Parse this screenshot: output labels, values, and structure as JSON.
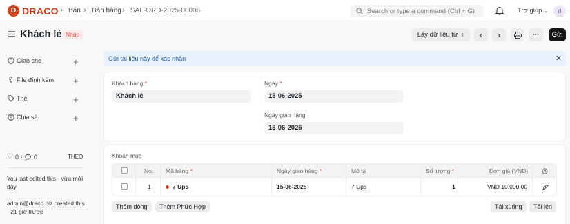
{
  "navbar": {
    "brand_initial": "D",
    "brand_name": "DRACO",
    "breadcrumbs": [
      "Bán",
      "Bán hàng",
      "SAL-ORD-2025-00006"
    ],
    "search_placeholder": "Search or type a command (Ctrl + G)",
    "help_label": "Trợ giúp",
    "avatar_initial": "d"
  },
  "page": {
    "title": "Khách lẻ",
    "status": "Nháp",
    "fetch_label": "Lấy dữ liệu từ",
    "more_label": "···",
    "submit_label": "Gửi"
  },
  "sidebar": {
    "items": [
      {
        "label": "Giao cho",
        "icon": "assign-icon"
      },
      {
        "label": "File đính kèm",
        "icon": "paperclip-icon"
      },
      {
        "label": "Thẻ",
        "icon": "tag-icon"
      },
      {
        "label": "Chia sẻ",
        "icon": "share-icon"
      }
    ],
    "likes": "0",
    "comments": "0",
    "follow_label": "THEO",
    "last_edited": "You last edited this · vừa mới đây",
    "created": "admin@draco.biz created this · 21 giờ trước"
  },
  "alert": {
    "text": "Gửi tài liệu này để xác nhận"
  },
  "form": {
    "customer_label": "Khách hàng",
    "customer_value": "Khách lẻ",
    "date_label": "Ngày",
    "date_value": "15-06-2025",
    "delivery_label": "Ngày giao hàng",
    "delivery_value": "15-06-2025"
  },
  "items": {
    "section_label": "Khoản mục",
    "columns": [
      "No.",
      "Mã hàng",
      "Ngày giao hàng",
      "Mô tả",
      "Số lượng",
      "Đơn giá (VND)"
    ],
    "rows": [
      {
        "no": "1",
        "item_code": "7 Ups",
        "delivery_date": "15-06-2025",
        "description": "7 Ups",
        "qty": "1",
        "rate": "VND 10.000,00"
      }
    ],
    "add_row": "Thêm dòng",
    "add_multiple": "Thêm Phức Hợp",
    "download": "Tải xuống",
    "upload": "Tải lên"
  },
  "colors": {
    "brand": "#d5421c",
    "required": "#e24c4c",
    "alert_bg": "#e8f2fc",
    "status_dot": "#c9471a"
  }
}
